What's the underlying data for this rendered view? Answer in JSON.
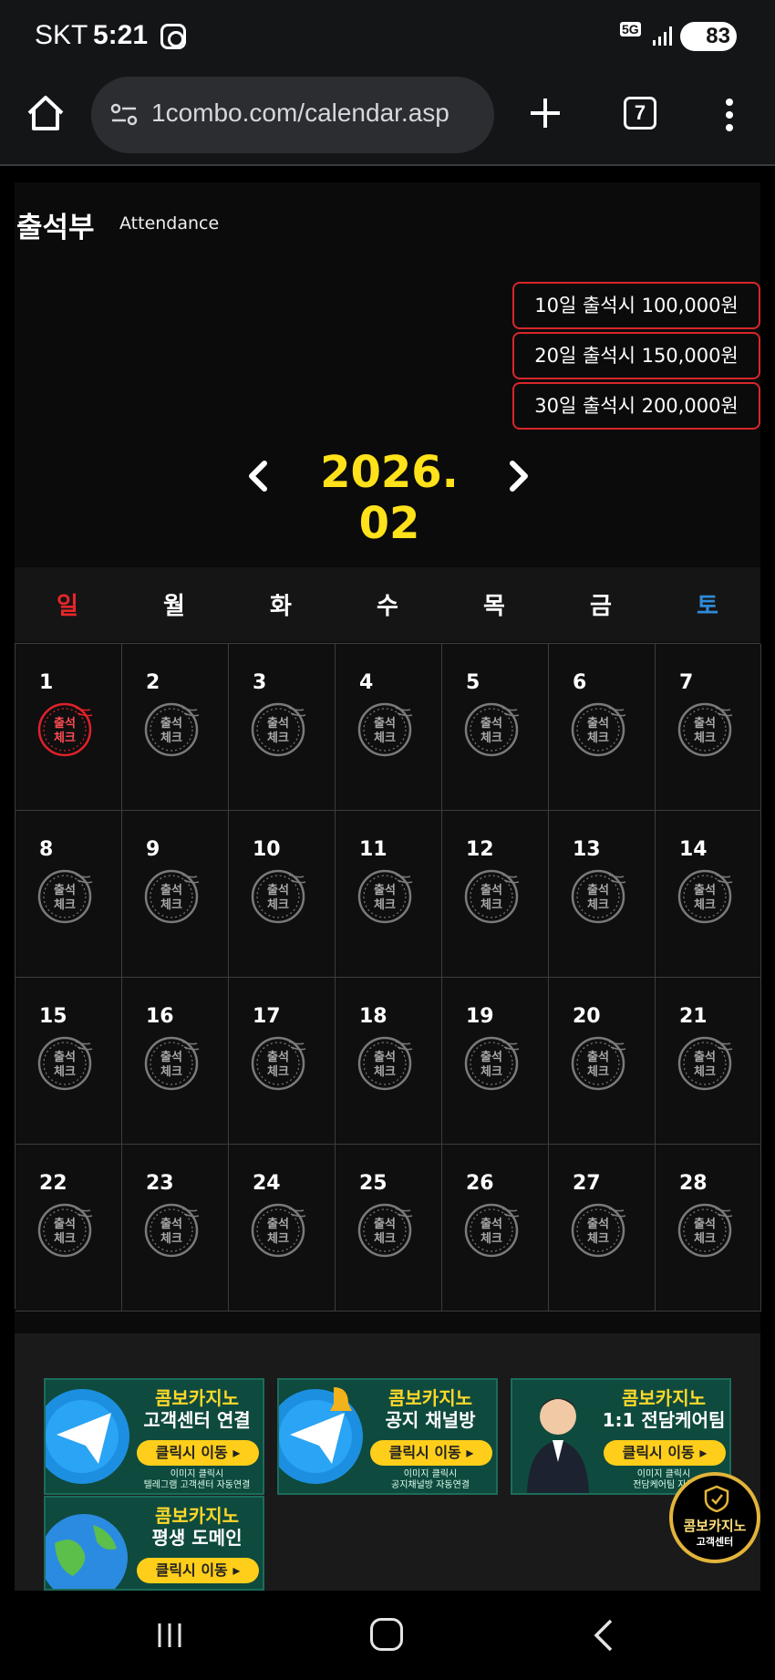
{
  "status_bar": {
    "carrier": "SKT",
    "time": "5:21",
    "network": "5G",
    "battery": "83"
  },
  "browser": {
    "url": "1combo.com/calendar.asp",
    "tab_count": "7"
  },
  "page": {
    "title": "출석부",
    "subtitle": "Attendance"
  },
  "rewards": [
    "10일 출석시 100,000원",
    "20일 출석시 150,000원",
    "30일 출석시 200,000원"
  ],
  "calendar": {
    "month_label": "2026. 02",
    "weekdays": [
      "일",
      "월",
      "화",
      "수",
      "목",
      "금",
      "토"
    ],
    "days": [
      "1",
      "2",
      "3",
      "4",
      "5",
      "6",
      "7",
      "8",
      "9",
      "10",
      "11",
      "12",
      "13",
      "14",
      "15",
      "16",
      "17",
      "18",
      "19",
      "20",
      "21",
      "22",
      "23",
      "24",
      "25",
      "26",
      "27",
      "28"
    ],
    "stamp_text": [
      "출석",
      "체크"
    ],
    "checked_days": [
      "1"
    ]
  },
  "banners": [
    {
      "title": "콤보카지노",
      "title2": "고객센터 연결",
      "button": "클릭시 이동 ▸",
      "sub1": "이미지 클릭시",
      "sub2": "텔레그램 고객센터 자동연결"
    },
    {
      "title": "콤보카지노",
      "title2": "공지 채널방",
      "button": "클릭시 이동 ▸",
      "sub1": "이미지 클릭시",
      "sub2": "공지채널방 자동연결"
    },
    {
      "title": "콤보카지노",
      "title2": "1:1 전담케어팀",
      "button": "클릭시 이동 ▸",
      "sub1": "이미지 클릭시",
      "sub2": "전담케어팀 자동"
    },
    {
      "title": "콤보카지노",
      "title2": "평생 도메인",
      "button": "클릭시 이동 ▸",
      "sub1": "",
      "sub2": ""
    }
  ],
  "cs_badge": {
    "line1": "콤보카지노",
    "line2": "고객센터"
  },
  "colors": {
    "accent_yellow": "#ffe21a",
    "sunday": "#e8262a",
    "saturday": "#2e8ad8",
    "reward_border": "#d9262b"
  }
}
